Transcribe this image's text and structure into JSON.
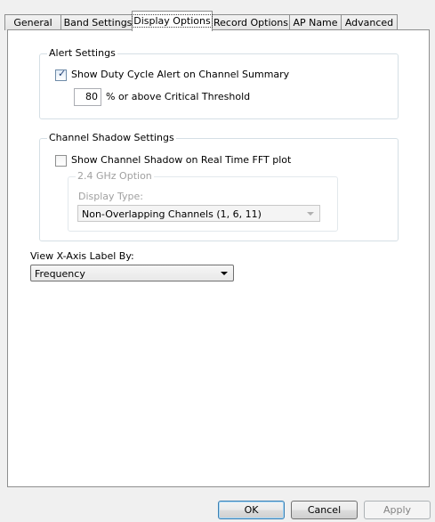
{
  "tabs": [
    {
      "label": "General"
    },
    {
      "label": "Band Settings"
    },
    {
      "label": "Display Options",
      "active": true
    },
    {
      "label": "Record Options"
    },
    {
      "label": "AP Name"
    },
    {
      "label": "Advanced"
    }
  ],
  "alert_settings": {
    "title": "Alert Settings",
    "duty_cycle_label": "Show Duty Cycle Alert on Channel Summary",
    "duty_cycle_checked": true,
    "threshold_value": "80",
    "threshold_label": "% or above Critical Threshold"
  },
  "channel_shadow": {
    "title": "Channel Shadow Settings",
    "show_label": "Show Channel Shadow on Real Time FFT plot",
    "show_checked": false,
    "option_title": "2.4 GHz Option",
    "display_type_label": "Display Type:",
    "display_type_value": "Non-Overlapping Channels (1, 6, 11)"
  },
  "x_axis": {
    "label": "View X-Axis Label By:",
    "value": "Frequency"
  },
  "buttons": {
    "ok": "OK",
    "cancel": "Cancel",
    "apply": "Apply"
  }
}
